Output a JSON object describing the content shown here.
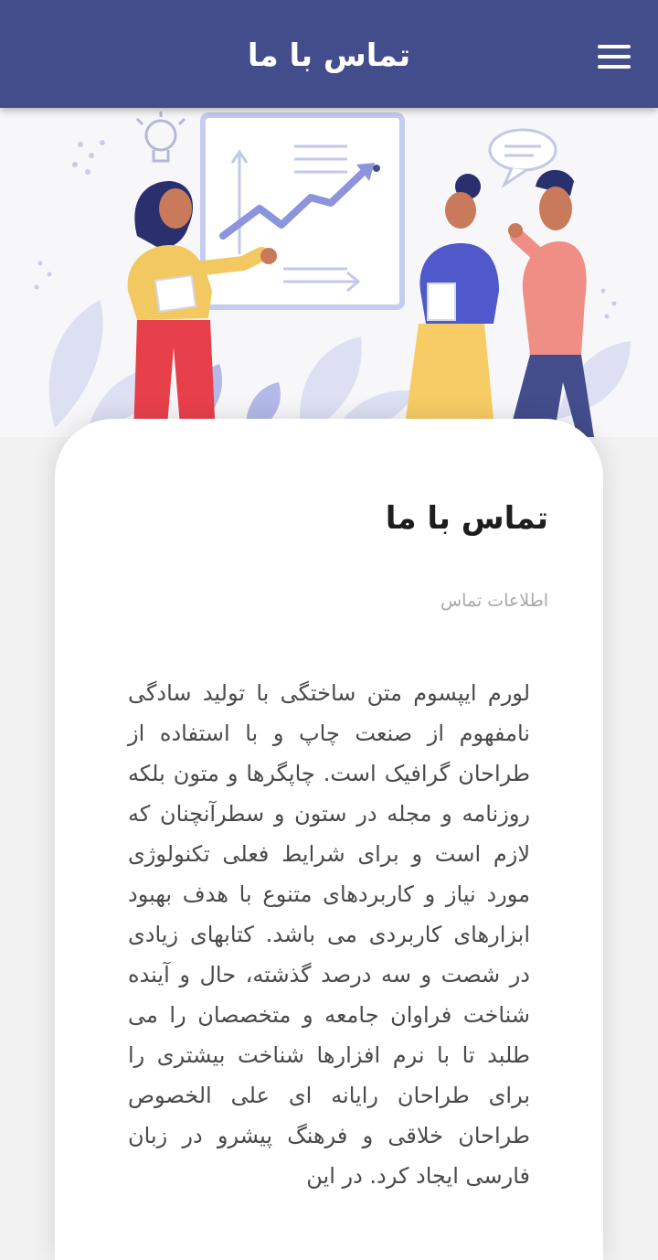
{
  "header": {
    "title": "تماس با ما",
    "menu_icon": "hamburger-menu-icon",
    "background_color": "#434d8c"
  },
  "hero": {
    "illustration": "business-team-presentation-illustration"
  },
  "card": {
    "title": "تماس با ما",
    "subtitle": "اطلاعات تماس",
    "body": "لورم ایپسوم متن ساختگی با تولید سادگی نامفهوم از صنعت چاپ و با استفاده از طراحان گرافیک است. چاپگرها و متون بلکه روزنامه و مجله در ستون و سطرآنچنان که لازم است و برای شرایط فعلی تکنولوژی مورد نیاز و کاربردهای متنوع با هدف بهبود ابزارهای کاربردی می باشد. کتابهای زیادی در شصت و سه درصد گذشته، حال و آینده شناخت فراوان جامعه و متخصصان را می طلبد تا با نرم افزارها شناخت بیشتری را برای طراحان رایانه ای علی الخصوص طراحان خلاقی و فرهنگ پیشرو در زبان فارسی ایجاد کرد. در این"
  }
}
